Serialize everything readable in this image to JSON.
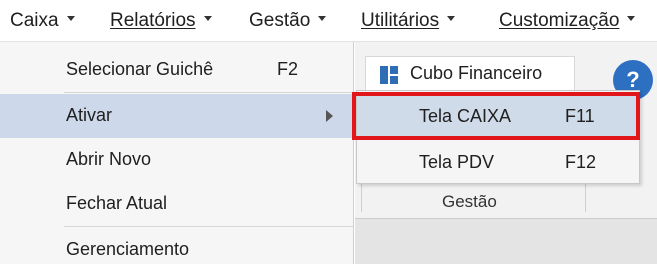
{
  "menubar": {
    "items": [
      {
        "label": "Caixa",
        "underline": false
      },
      {
        "label": "Relatórios",
        "underline": true
      },
      {
        "label": "Gestão",
        "underline": false
      },
      {
        "label": "Utilitários",
        "underline": true
      },
      {
        "label": "Customização",
        "underline": true
      }
    ]
  },
  "dropdown": {
    "items": [
      {
        "label": "Selecionar Guichê",
        "shortcut": "F2"
      },
      {
        "label": "Ativar",
        "shortcut": ""
      },
      {
        "label": "Abrir Novo",
        "shortcut": ""
      },
      {
        "label": "Fechar Atual",
        "shortcut": ""
      },
      {
        "label": "Gerenciamento",
        "shortcut": ""
      }
    ]
  },
  "submenu": {
    "items": [
      {
        "label": "Tela CAIXA",
        "shortcut": "F11"
      },
      {
        "label": "Tela PDV",
        "shortcut": "F12"
      }
    ]
  },
  "ribbon": {
    "button_label": "Cubo Financeiro",
    "group_label": "Gestão",
    "help_badge": "?"
  },
  "colors": {
    "highlight": "#e0161b",
    "active_bg": "#cdd9ea",
    "accent": "#2d6fc0"
  }
}
